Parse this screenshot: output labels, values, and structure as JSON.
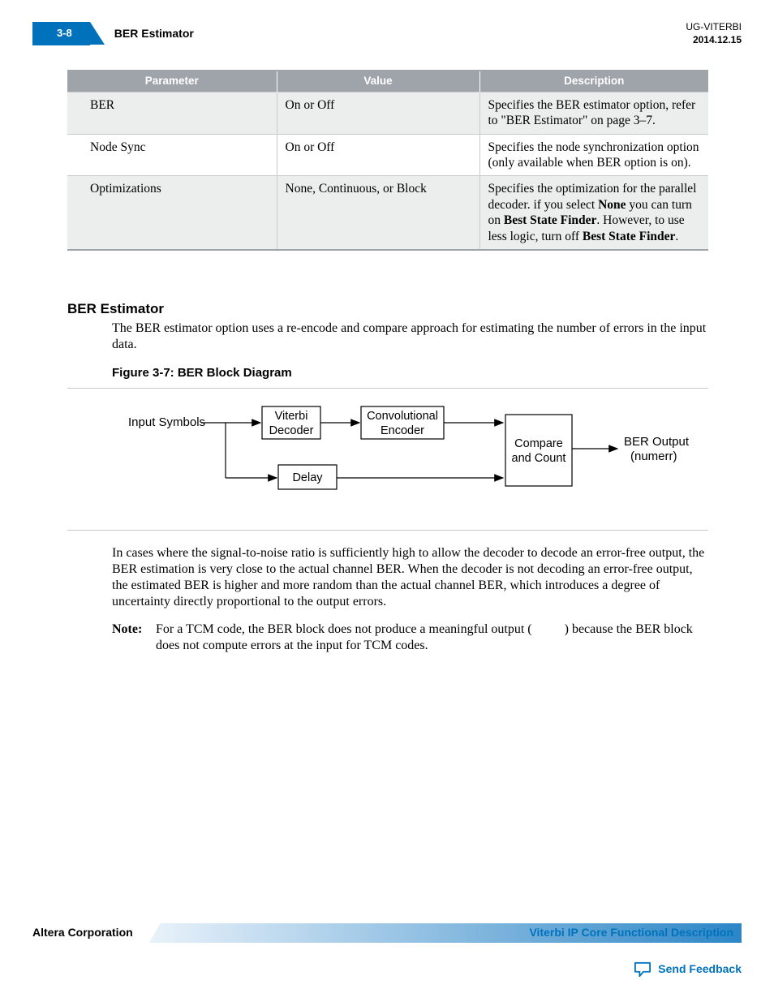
{
  "header": {
    "page_number": "3-8",
    "section_title": "BER Estimator",
    "doc_id": "UG-VITERBI",
    "date": "2014.12.15"
  },
  "table": {
    "headers": [
      "Parameter",
      "Value",
      "Description"
    ],
    "rows": [
      {
        "param": "BER",
        "value": "On or Off",
        "desc_plain": "Specifies the BER estimator option, refer to \"BER Estimator\" on page 3–7."
      },
      {
        "param": "Node Sync",
        "value": "On or Off",
        "desc_plain": "Specifies the node synchronization option (only available when BER option is on)."
      },
      {
        "param": "Optimizations",
        "value": "None, Continuous, or Block",
        "desc_pre": "Specifies the optimization for the parallel decoder. if you select ",
        "desc_b1": "None",
        "desc_mid1": " you can turn on ",
        "desc_b2": "Best State Finder",
        "desc_mid2": ". However, to use less logic, turn off ",
        "desc_b3": "Best State Finder",
        "desc_post": "."
      }
    ]
  },
  "section": {
    "heading": "BER Estimator",
    "intro": "The BER estimator option uses a re-encode and compare approach for estimating the number of errors in the input data.",
    "fig_title": "Figure 3-7: BER Block Diagram",
    "diagram": {
      "input_label": "Input Symbols",
      "viterbi": "Viterbi Decoder",
      "conv": "Convolutional Encoder",
      "delay": "Delay",
      "compare": "Compare and Count",
      "output": "BER Output (numerr)"
    },
    "para2": "In cases where the signal-to-noise ratio is sufficiently high to allow the decoder to decode an error-free output, the BER estimation is very close to the actual channel BER. When the decoder is not decoding an error-free output, the estimated BER is higher and more random than the actual channel BER, which introduces a degree of uncertainty directly proportional to the output errors.",
    "note_label": "Note:",
    "note_text_pre": "For a TCM code, the BER block does not produce a meaningful output (",
    "note_blank": "          ",
    "note_text_post": ") because the BER block does not compute errors at the input for TCM codes."
  },
  "footer": {
    "company": "Altera Corporation",
    "chapter": "Viterbi IP Core Functional Description",
    "feedback": "Send Feedback"
  }
}
